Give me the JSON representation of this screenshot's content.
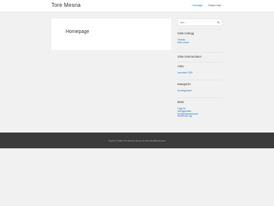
{
  "header": {
    "site_title": "Tore Mesna",
    "nav": [
      {
        "label": "Homepage",
        "active": true
      },
      {
        "label": "Sample Page",
        "active": false
      }
    ]
  },
  "main": {
    "page_title": "Homepage"
  },
  "sidebar": {
    "search": {
      "value": "",
      "placeholder": "Søk ..."
    },
    "recent_posts": {
      "title": "Siste innlegg",
      "items": [
        "Testfolio",
        "Hello world!"
      ]
    },
    "recent_comments": {
      "title": "Siste kommentarer"
    },
    "archives": {
      "title": "Arkiv",
      "items": [
        "november 2020"
      ]
    },
    "categories": {
      "title": "Kategorier",
      "items": [
        "Uncategorized"
      ]
    },
    "meta": {
      "title": "Meta",
      "items": [
        "Logg inn",
        "Innleggsmater",
        "Kommentarstrømmer",
        "WordPress.org"
      ]
    }
  },
  "footer": {
    "text": "Kopirett © 2022 Tore Mesna | Drevet av Astra WordPress-tema"
  },
  "colors": {
    "accent": "#1e73be",
    "footer_bg": "#3b3b3b",
    "page_bg": "#f1f1f1"
  }
}
